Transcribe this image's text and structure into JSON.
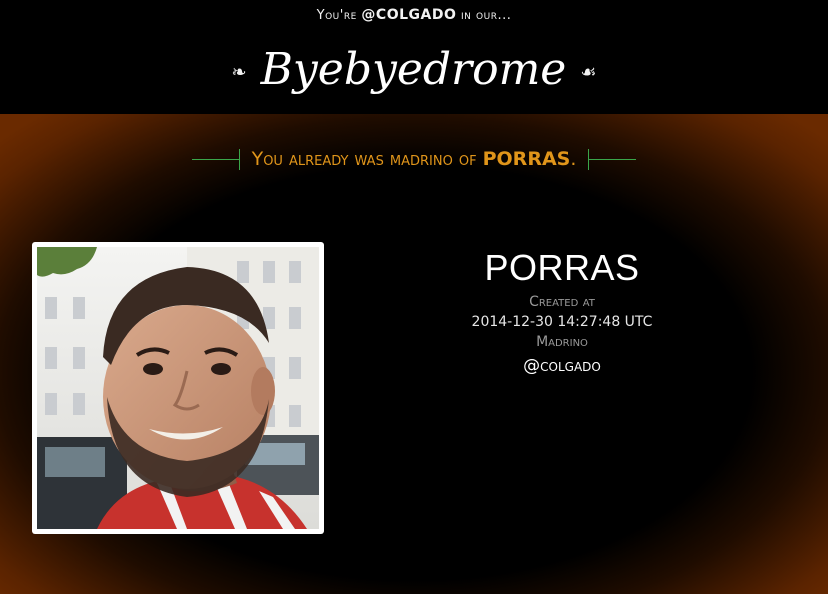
{
  "header": {
    "tagline_prefix": "You're",
    "username": "@COLGADO",
    "tagline_suffix": "in our...",
    "site_title": "Byebyedrome",
    "fleuron_left": "❧",
    "fleuron_right": "☙"
  },
  "notice": {
    "prefix": "You already was madrino of",
    "group": "PORRAS",
    "suffix": "."
  },
  "group": {
    "name": "PORRAS",
    "created_label": "Created at",
    "created_value": "2014-12-30 14:27:48 UTC",
    "madrino_label": "Madrino",
    "madrino_value": "@colgado"
  },
  "colors": {
    "accent": "#e0951a",
    "rule": "#3aa64a",
    "glow": "#6a2a00"
  }
}
